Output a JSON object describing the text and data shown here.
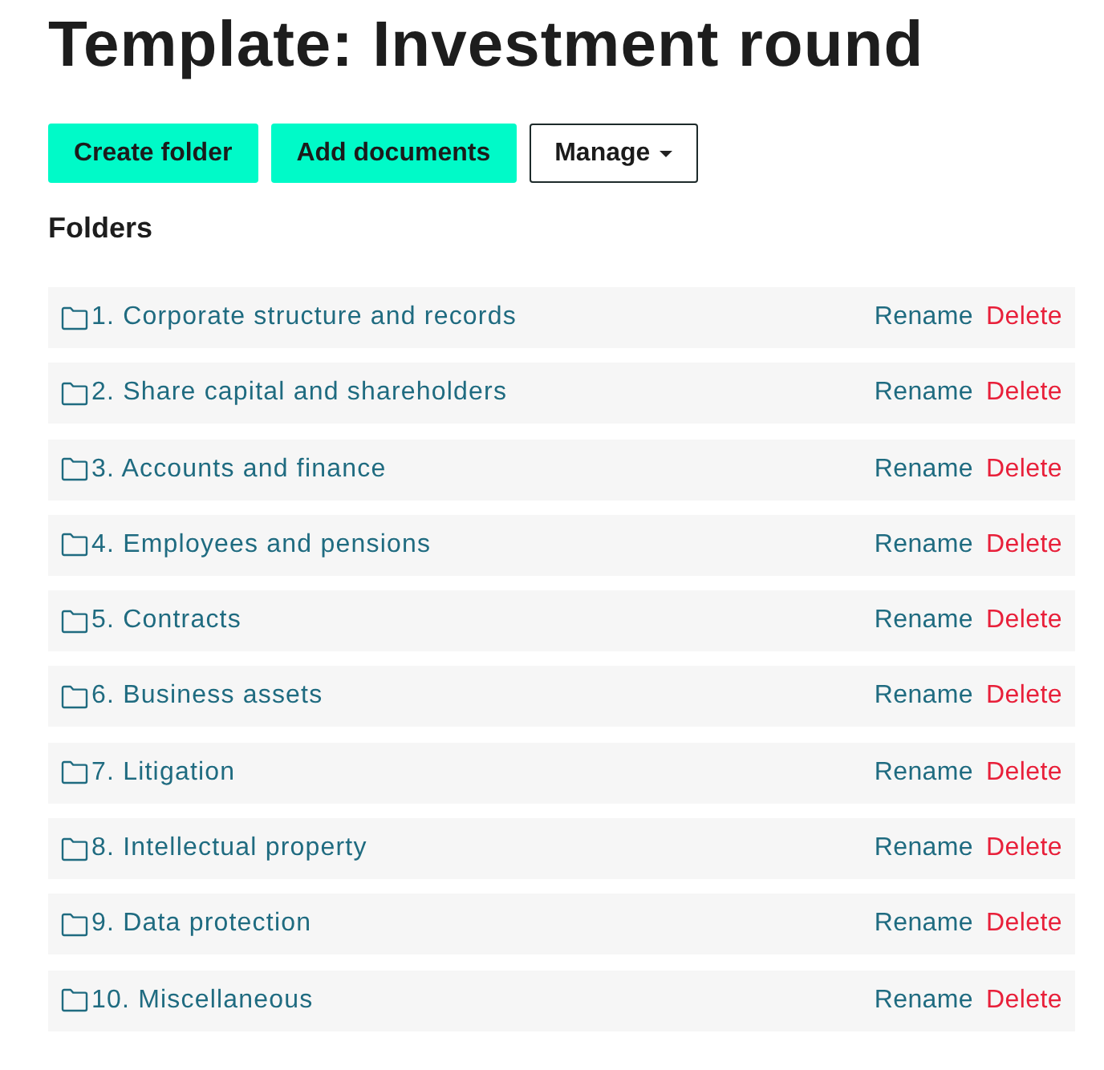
{
  "title": "Template: Investment round",
  "buttons": [
    {
      "label": "Create folder",
      "kind": "primary"
    },
    {
      "label": "Add documents",
      "kind": "primary"
    },
    {
      "label": "Manage",
      "kind": "dropdown"
    }
  ],
  "folders_heading": "Folders",
  "folders": [
    {
      "name": "1. Corporate structure and records",
      "actions": [
        {
          "label": "Rename",
          "kind": "rename"
        },
        {
          "label": "Delete",
          "kind": "delete"
        }
      ]
    },
    {
      "name": "2. Share capital and shareholders",
      "actions": [
        {
          "label": "Rename",
          "kind": "rename"
        },
        {
          "label": "Delete",
          "kind": "delete"
        }
      ]
    },
    {
      "name": "3. Accounts and finance",
      "actions": [
        {
          "label": "Rename",
          "kind": "rename"
        },
        {
          "label": "Delete",
          "kind": "delete"
        }
      ]
    },
    {
      "name": "4. Employees and pensions",
      "actions": [
        {
          "label": "Rename",
          "kind": "rename"
        },
        {
          "label": "Delete",
          "kind": "delete"
        }
      ]
    },
    {
      "name": "5. Contracts",
      "actions": [
        {
          "label": "Rename",
          "kind": "rename"
        },
        {
          "label": "Delete",
          "kind": "delete"
        }
      ]
    },
    {
      "name": "6. Business assets",
      "actions": [
        {
          "label": "Rename",
          "kind": "rename"
        },
        {
          "label": "Delete",
          "kind": "delete"
        }
      ]
    },
    {
      "name": "7. Litigation",
      "actions": [
        {
          "label": "Rename",
          "kind": "rename"
        },
        {
          "label": "Delete",
          "kind": "delete"
        }
      ]
    },
    {
      "name": "8. Intellectual property",
      "actions": [
        {
          "label": "Rename",
          "kind": "rename"
        },
        {
          "label": "Delete",
          "kind": "delete"
        }
      ]
    },
    {
      "name": "9. Data protection",
      "actions": [
        {
          "label": "Rename",
          "kind": "rename"
        },
        {
          "label": "Delete",
          "kind": "delete"
        }
      ]
    },
    {
      "name": "10. Miscellaneous",
      "actions": [
        {
          "label": "Rename",
          "kind": "rename"
        },
        {
          "label": "Delete",
          "kind": "delete"
        }
      ]
    }
  ]
}
